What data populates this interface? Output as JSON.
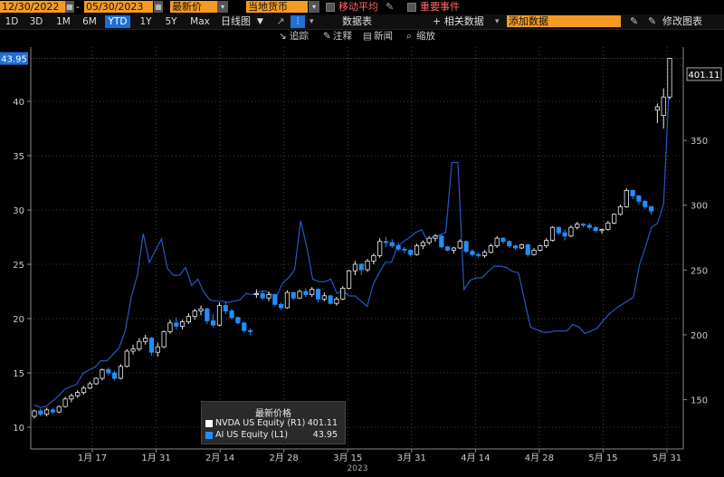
{
  "toolbar": {
    "start_date": "12/30/2022",
    "end_date": "05/30/2023",
    "price_field": "最新价",
    "currency_field": "当地货币",
    "moving_avg_label": "移动平均",
    "events_label": "重要事件"
  },
  "periods": [
    "1D",
    "3D",
    "1M",
    "6M",
    "YTD",
    "1Y",
    "5Y",
    "Max"
  ],
  "active_period": "YTD",
  "chart_type_label": "日线图",
  "table_label": "数据表",
  "related_label": "+ 相关数据",
  "add_data_placeholder": "添加数据",
  "edit_label": "修改图表",
  "tools": [
    "追踪",
    "注释",
    "新闻",
    "缩放"
  ],
  "colors": {
    "nvda": "#ffffff",
    "ai": "#1f8fff",
    "line": "#2a56c6",
    "accent": "#f59b23"
  },
  "legend": {
    "title": "最新价格",
    "items": [
      {
        "name": "NVDA US Equity (R1)",
        "value": "401.11"
      },
      {
        "name": "AI US Equity (L1)",
        "value": "43.95"
      }
    ]
  },
  "chart_data": {
    "type": "line",
    "x_ticks": [
      "1月 17",
      "1月 31",
      "2月 14",
      "2月 28",
      "3月 15",
      "3月 31",
      "4月 14",
      "4月 28",
      "5月 15",
      "5月 31"
    ],
    "x_year": "2023",
    "left_axis": {
      "ticks": [
        10,
        15,
        20,
        25,
        30,
        35,
        40
      ],
      "range": [
        8,
        45
      ]
    },
    "right_axis": {
      "ticks": [
        150,
        200,
        250,
        300,
        350
      ],
      "range": [
        112,
        422
      ]
    },
    "last_labels": {
      "left": "43.95",
      "right": "401.11"
    },
    "series": [
      {
        "name": "AI US Equity",
        "axis": "left",
        "style": "candles",
        "ohlc": [
          [
            11.0,
            11.6,
            10.8,
            11.5
          ],
          [
            11.5,
            11.7,
            11.0,
            11.2
          ],
          [
            11.2,
            11.8,
            11.0,
            11.6
          ],
          [
            11.6,
            11.8,
            11.2,
            11.4
          ],
          [
            11.4,
            12.0,
            11.3,
            11.9
          ],
          [
            11.9,
            12.8,
            11.8,
            12.6
          ],
          [
            12.6,
            13.1,
            12.3,
            12.9
          ],
          [
            12.9,
            13.4,
            12.7,
            13.2
          ],
          [
            13.2,
            13.8,
            13.0,
            13.6
          ],
          [
            13.6,
            14.2,
            13.5,
            14.0
          ],
          [
            14.0,
            14.6,
            13.9,
            14.5
          ],
          [
            14.5,
            15.4,
            14.3,
            15.3
          ],
          [
            15.3,
            15.5,
            14.8,
            15.0
          ],
          [
            15.0,
            15.2,
            14.3,
            14.5
          ],
          [
            14.5,
            15.8,
            14.4,
            15.6
          ],
          [
            15.6,
            17.2,
            15.5,
            17.0
          ],
          [
            17.0,
            17.6,
            16.7,
            17.2
          ],
          [
            17.2,
            18.2,
            17.0,
            17.9
          ],
          [
            17.9,
            18.5,
            17.6,
            18.2
          ],
          [
            18.2,
            18.3,
            16.6,
            16.9
          ],
          [
            16.9,
            17.8,
            16.5,
            17.4
          ],
          [
            17.4,
            18.9,
            17.3,
            18.8
          ],
          [
            18.8,
            19.9,
            18.6,
            19.6
          ],
          [
            19.6,
            20.1,
            19.0,
            19.3
          ],
          [
            19.3,
            19.9,
            19.0,
            19.7
          ],
          [
            19.7,
            20.5,
            19.5,
            20.2
          ],
          [
            20.2,
            20.9,
            19.9,
            20.7
          ],
          [
            20.7,
            21.2,
            20.3,
            20.9
          ],
          [
            20.9,
            21.0,
            19.5,
            19.8
          ],
          [
            19.8,
            20.4,
            19.2,
            19.4
          ],
          [
            19.4,
            21.5,
            19.3,
            21.2
          ],
          [
            21.2,
            21.6,
            20.4,
            20.7
          ],
          [
            20.7,
            20.9,
            19.9,
            20.1
          ],
          [
            20.1,
            20.2,
            19.5,
            19.6
          ],
          [
            19.6,
            19.7,
            18.7,
            18.9
          ],
          [
            18.9,
            19.1,
            18.5,
            18.8
          ],
          [
            22.2,
            22.7,
            21.9,
            22.3
          ],
          [
            22.3,
            22.6,
            21.7,
            21.9
          ],
          [
            21.9,
            22.5,
            21.6,
            22.2
          ],
          [
            22.2,
            22.3,
            21.1,
            21.3
          ],
          [
            21.3,
            21.5,
            20.8,
            21.0
          ],
          [
            21.0,
            22.6,
            20.9,
            22.4
          ],
          [
            22.4,
            22.5,
            21.7,
            21.9
          ],
          [
            21.9,
            22.7,
            21.8,
            22.5
          ],
          [
            22.5,
            22.8,
            22.0,
            22.2
          ],
          [
            22.2,
            22.9,
            22.0,
            22.7
          ],
          [
            22.7,
            22.8,
            21.5,
            21.8
          ],
          [
            21.8,
            22.4,
            21.6,
            22.1
          ],
          [
            22.1,
            22.2,
            21.3,
            21.4
          ],
          [
            21.4,
            22.0,
            21.2,
            21.8
          ],
          [
            21.8,
            23.0,
            21.7,
            22.8
          ],
          [
            22.8,
            24.5,
            22.7,
            24.4
          ],
          [
            24.4,
            25.3,
            24.0,
            25.0
          ],
          [
            25.0,
            25.1,
            24.0,
            24.5
          ],
          [
            24.5,
            25.5,
            24.3,
            25.3
          ],
          [
            25.3,
            26.0,
            25.0,
            25.8
          ],
          [
            25.8,
            27.4,
            25.6,
            27.1
          ],
          [
            27.1,
            27.5,
            26.6,
            27.0
          ],
          [
            27.0,
            27.3,
            26.5,
            26.7
          ],
          [
            26.7,
            27.0,
            26.2,
            26.4
          ],
          [
            26.4,
            26.6,
            26.0,
            26.3
          ],
          [
            26.3,
            26.4,
            25.7,
            25.9
          ],
          [
            25.9,
            26.9,
            25.8,
            26.7
          ],
          [
            26.7,
            27.2,
            26.4,
            27.0
          ],
          [
            27.0,
            27.6,
            26.8,
            27.4
          ],
          [
            27.4,
            27.8,
            27.1,
            27.6
          ],
          [
            27.6,
            27.7,
            26.5,
            26.6
          ],
          [
            26.6,
            26.7,
            26.2,
            26.3
          ],
          [
            26.3,
            26.6,
            26.0,
            26.5
          ],
          [
            26.5,
            27.3,
            26.4,
            27.1
          ],
          [
            27.1,
            27.2,
            26.0,
            26.2
          ],
          [
            26.2,
            26.4,
            25.7,
            25.9
          ],
          [
            25.9,
            26.1,
            25.6,
            25.8
          ],
          [
            25.8,
            26.3,
            25.6,
            26.1
          ],
          [
            26.1,
            26.9,
            26.0,
            26.7
          ],
          [
            26.7,
            27.6,
            26.5,
            27.4
          ],
          [
            27.4,
            27.5,
            26.9,
            27.1
          ],
          [
            27.1,
            27.2,
            26.5,
            26.7
          ],
          [
            26.7,
            26.8,
            26.3,
            26.5
          ],
          [
            26.5,
            26.9,
            26.4,
            26.8
          ],
          [
            26.8,
            26.9,
            25.7,
            25.9
          ],
          [
            25.9,
            26.5,
            25.8,
            26.3
          ],
          [
            26.3,
            26.8,
            26.2,
            26.7
          ],
          [
            26.7,
            27.4,
            26.5,
            27.2
          ],
          [
            27.2,
            28.5,
            27.1,
            28.4
          ],
          [
            28.4,
            28.5,
            27.7,
            27.9
          ],
          [
            27.9,
            28.2,
            27.2,
            27.6
          ],
          [
            27.6,
            28.6,
            27.5,
            28.4
          ],
          [
            28.4,
            28.9,
            28.2,
            28.7
          ],
          [
            28.7,
            28.8,
            28.4,
            28.6
          ],
          [
            28.6,
            28.8,
            28.2,
            28.4
          ],
          [
            28.4,
            28.5,
            27.9,
            28.1
          ],
          [
            28.1,
            28.3,
            27.8,
            28.2
          ],
          [
            28.2,
            29.0,
            28.1,
            28.8
          ],
          [
            28.8,
            29.7,
            28.7,
            29.6
          ],
          [
            29.6,
            30.5,
            29.5,
            30.3
          ],
          [
            30.3,
            32.0,
            30.2,
            31.8
          ],
          [
            31.8,
            31.9,
            31.0,
            31.3
          ],
          [
            31.3,
            31.4,
            30.5,
            30.8
          ],
          [
            30.8,
            30.9,
            30.1,
            30.3
          ],
          [
            30.3,
            30.4,
            29.6,
            29.9
          ],
          [
            39.2,
            39.8,
            38.0,
            39.5
          ],
          [
            38.7,
            41.2,
            37.5,
            40.4
          ],
          [
            40.4,
            44.0,
            40.2,
            43.95
          ]
        ]
      },
      {
        "name": "NVDA US Equity",
        "axis": "right",
        "style": "line",
        "values": [
          146,
          144,
          145,
          149,
          153,
          158,
          160,
          162,
          170,
          173,
          175,
          180,
          180,
          185,
          190,
          203,
          229,
          246,
          278,
          256,
          265,
          274,
          251,
          246,
          246,
          252,
          238,
          243,
          233,
          227,
          226,
          226,
          225,
          226,
          227,
          232,
          231,
          233,
          234,
          232,
          229,
          240,
          244,
          250,
          288,
          268,
          243,
          241,
          241,
          243,
          232,
          234,
          230,
          230,
          226,
          222,
          239,
          248,
          256,
          256,
          268,
          272,
          275,
          279,
          281,
          272,
          276,
          277,
          279,
          333,
          333,
          235,
          242,
          244,
          244,
          249,
          253,
          253,
          252,
          249,
          248,
          227,
          206,
          204,
          202,
          202,
          203,
          203,
          203,
          208,
          206,
          201,
          203,
          205,
          211,
          216,
          220,
          223,
          226,
          229,
          254,
          268,
          283,
          286,
          301,
          401
        ]
      }
    ]
  }
}
